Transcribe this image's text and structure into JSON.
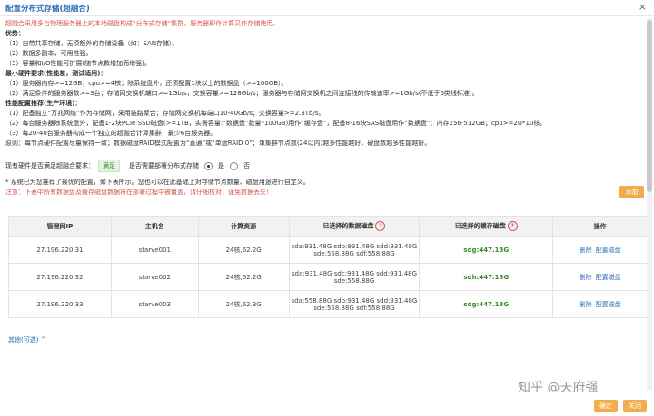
{
  "window": {
    "title": "配置分布式存储(超融合)",
    "close": "×"
  },
  "intro": "超融合采用多台物理服务器上的本地磁盘构成“分布式存储”集群，服务器即作计算又作存储使用。",
  "advantages": {
    "heading": "优势：",
    "items": [
      "（1）自带共享存储，无须额外的存储设备（如：SAN存储）。",
      "（2）数据多副本，可用性强。",
      "（3）容量和I/O性能可扩展(随节点数增加而增强)。"
    ]
  },
  "min_hw": {
    "heading": "最小硬件要求(性能差，测试适用)：",
    "items": [
      "（1）服务器内存>=12GB；cpu>=4核；除系统盘外，还须配置1块以上的数据盘（>=100GB）。",
      "（2）满足条件的服务器数>=3台；存储网交换机端口>=1Gb/s，交换容量>=128Gb/s；服务器与存储网交换机之间连接线的传输速率>=1Gb/s(不低于6类线标准)。"
    ]
  },
  "recommended": {
    "heading": "性能配置推荐(生产环境)：",
    "items": [
      "（1）配备独立“万兆网络”作为存储网，采用链路聚合；存储网交换机每端口10-40Gb/s；交换容量>=2.3Tb/s。",
      "（2）每台服务器除系统盘外，配备1-2块PCIe SSD磁盘(>=1TB，实需容量:“数据盘”数量*100GB)用作“缓存盘”，配备8-16块SAS磁盘用作“数据盘”：内存256-512GB；cpu>=2U*10核。",
      "（3）每20-40台服务器构成一个独立的超融合计算集群，最少6台服务器。"
    ],
    "principle": "原则：每节点硬件配置尽量保持一致；数据磁盘RAID模式配置为“直通”或“单盘RAID 0”；单集群节点数(24以内)越多性能越好，硬盘数越多性能越好。"
  },
  "form": {
    "hw_label": "现有硬件是否满足超融合要求：",
    "hw_status": "满足",
    "deploy_label": "是否需要部署分布式存储",
    "yes": "是",
    "no": "否"
  },
  "notes": {
    "auto_config": "* 系统已为您推荐了最优的配置，如下表所示。您也可以在此基础上对存储节点数量、磁盘用途进行自定义。",
    "warning": "注意：下表中所有数据盘及缓存磁盘数据将在部署过程中被覆盖，请仔细核对，谨免数据丢失！"
  },
  "add_button": "添加",
  "table": {
    "headers": [
      "管理网IP",
      "主机名",
      "计算资源",
      "已选择的数据磁盘",
      "已选择的缓存磁盘",
      "操作"
    ],
    "help_icon": "?",
    "rows": [
      {
        "ip": "27.196.220.31",
        "host": "starve001",
        "compute": "24核,62.2G",
        "data_line1": "sda:931.48G sdb:931.48G sdd:931.48G",
        "data_line2": "sde:558.88G sdf:558.88G",
        "cache": "sdg:447.13G",
        "delete": "删除",
        "config": "配置磁盘"
      },
      {
        "ip": "27.196.220.32",
        "host": "starve002",
        "compute": "24核,62.2G",
        "data_line1": "sda:931.48G sdc:931.48G sdd:931.48G",
        "data_line2": "sde:558.88G",
        "cache": "sdh:447.13G",
        "delete": "删除",
        "config": "配置磁盘"
      },
      {
        "ip": "27.196.220.33",
        "host": "starve003",
        "compute": "24核,62.3G",
        "data_line1": "sda:558.88G sdb:931.48G sdd:931.48G",
        "data_line2": "sde:558.88G sdf:558.88G",
        "cache": "sdg:447.13G",
        "delete": "删除",
        "config": "配置磁盘"
      }
    ]
  },
  "other_link": "其他(可选)",
  "other_arrow": "^",
  "footer": {
    "ok": "确定",
    "cancel": "关闭"
  },
  "watermark": "知乎 @天府强"
}
